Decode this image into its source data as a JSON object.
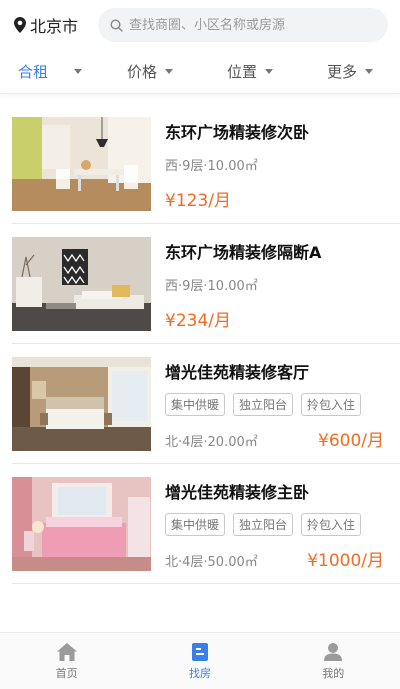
{
  "header": {
    "city": "北京市",
    "search_placeholder": "查找商圈、小区名称或房源"
  },
  "filters": [
    {
      "label": "合租",
      "active": true
    },
    {
      "label": "价格",
      "active": false
    },
    {
      "label": "位置",
      "active": false
    },
    {
      "label": "更多",
      "active": false
    }
  ],
  "listings": [
    {
      "title": "东环广场精装修次卧",
      "meta": "西·9层·10.00㎡",
      "price": "¥123/月",
      "tags": []
    },
    {
      "title": "东环广场精装修隔断A",
      "meta": "西·9层·10.00㎡",
      "price": "¥234/月",
      "tags": []
    },
    {
      "title": "增光佳苑精装修客厅",
      "meta": "北·4层·20.00㎡",
      "price": "¥600/月",
      "tags": [
        "集中供暖",
        "独立阳台",
        "拎包入住"
      ]
    },
    {
      "title": "增光佳苑精装修主卧",
      "meta": "北·4层·50.00㎡",
      "price": "¥1000/月",
      "tags": [
        "集中供暖",
        "独立阳台",
        "拎包入住"
      ]
    }
  ],
  "tabbar": [
    {
      "label": "首页",
      "icon": "home-icon",
      "active": false
    },
    {
      "label": "找房",
      "icon": "find-house-icon",
      "active": true
    },
    {
      "label": "我的",
      "icon": "user-icon",
      "active": false
    }
  ],
  "colors": {
    "accent": "#3a7ee8",
    "price": "#f26b21"
  }
}
